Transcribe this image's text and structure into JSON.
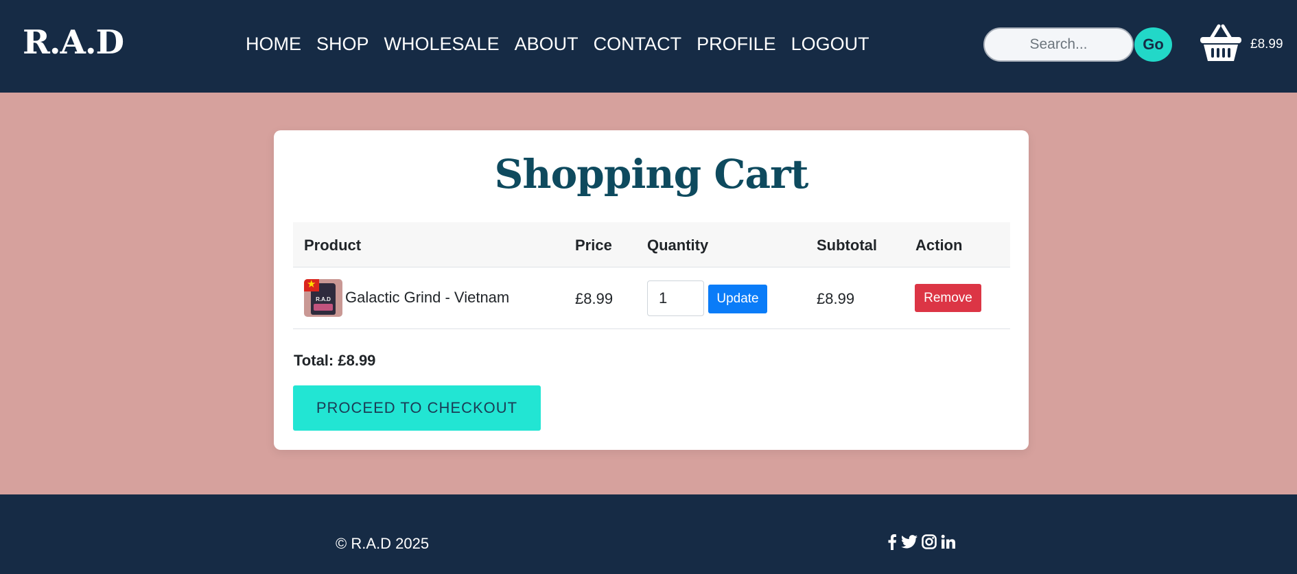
{
  "navbar": {
    "logo": "R.A.D",
    "links": [
      "HOME",
      "SHOP",
      "WHOLESALE",
      "ABOUT",
      "CONTACT",
      "PROFILE",
      "LOGOUT"
    ],
    "search_placeholder": "Search...",
    "go_label": "Go",
    "cart_total": "£8.99",
    "cart_icon": "basket-icon"
  },
  "cart": {
    "title": "Shopping Cart",
    "columns": [
      "Product",
      "Price",
      "Quantity",
      "Subtotal",
      "Action"
    ],
    "items": [
      {
        "product": "Galactic Grind - Vietnam",
        "thumb_label": "R.A.D",
        "price": "£8.99",
        "quantity": "1",
        "update_label": "Update",
        "subtotal": "£8.99",
        "remove_label": "Remove"
      }
    ],
    "total": "Total: £8.99",
    "checkout_label": "PROCEED TO CHECKOUT"
  },
  "footer": {
    "copyright": "© R.A.D 2025",
    "social_icons": [
      "facebook-icon",
      "twitter-icon",
      "instagram-icon",
      "linkedin-icon"
    ]
  },
  "colors": {
    "navbar": "#162b45",
    "page_background": "#d6a19d",
    "accent": "#22d8c8",
    "update": "#0a7cf8",
    "remove": "#dc3545",
    "title": "#0e4a5e"
  }
}
